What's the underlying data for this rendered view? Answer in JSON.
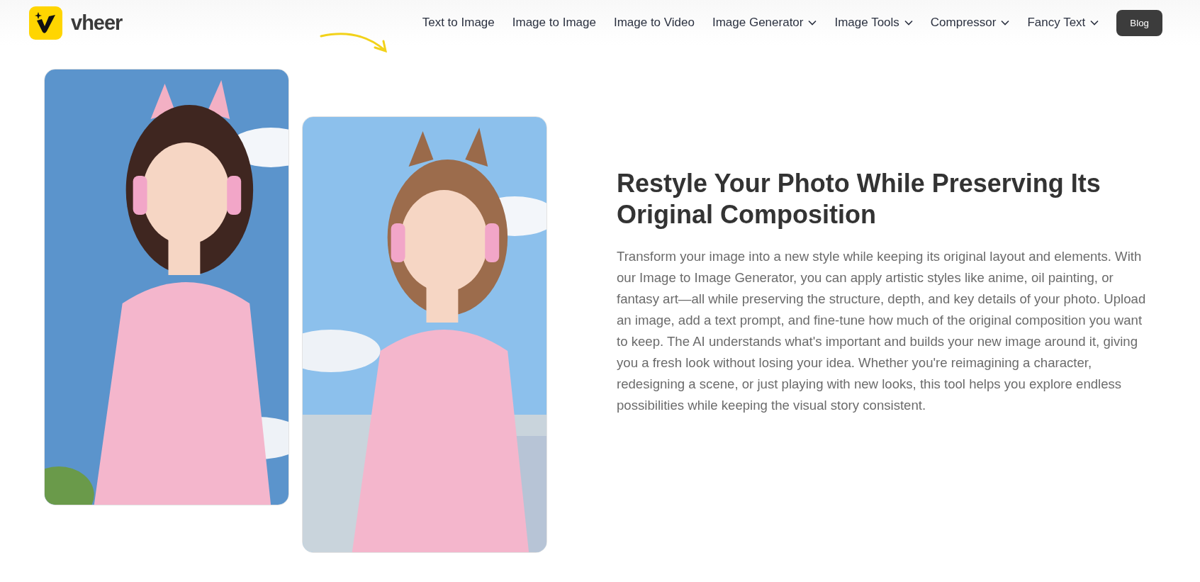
{
  "header": {
    "logo_text": "vheer",
    "nav": [
      {
        "label": "Text to Image",
        "kind": "link"
      },
      {
        "label": "Image to Image",
        "kind": "link"
      },
      {
        "label": "Image to Video",
        "kind": "link"
      },
      {
        "label": "Image Generator",
        "kind": "dropdown"
      },
      {
        "label": "Image Tools",
        "kind": "dropdown"
      },
      {
        "label": "Compressor",
        "kind": "dropdown"
      },
      {
        "label": "Fancy Text",
        "kind": "dropdown"
      },
      {
        "label": "Blog",
        "kind": "button"
      }
    ]
  },
  "section": {
    "heading": "Restyle Your Photo While Preserving Its Original Composition",
    "body": "Transform your image into a new style while keeping its original layout and elements. With our Image to Image Generator, you can apply artistic styles like anime, oil painting, or fantasy art—all while preserving the structure, depth, and key details of your photo. Upload an image, add a text prompt, and fine-tune how much of the original composition you want to keep. The AI understands what's important and builds your new image around it, giving you a fresh look without losing your idea. Whether you're reimagining a character, redesigning a scene, or just playing with new looks, this tool helps you explore endless possibilities while keeping the visual story consistent."
  }
}
